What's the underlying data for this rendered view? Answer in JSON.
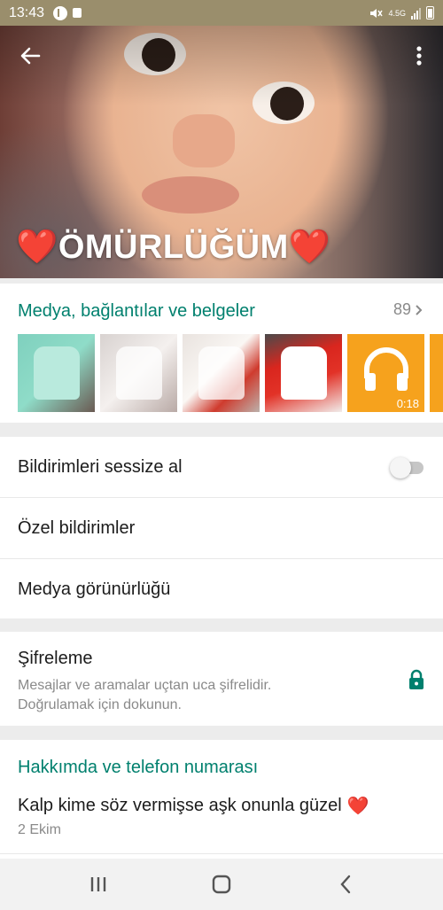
{
  "status_bar": {
    "time": "13:43",
    "network": "4.5G"
  },
  "header": {
    "name": "ÖMÜRLÜĞÜM",
    "heart": "❤️",
    "back_icon": "arrow-left-icon",
    "menu_icon": "more-vert-icon"
  },
  "media": {
    "title": "Medya, bağlantılar ve belgeler",
    "count": "89",
    "thumbnails": [
      {
        "kind": "image"
      },
      {
        "kind": "image"
      },
      {
        "kind": "image"
      },
      {
        "kind": "image"
      },
      {
        "kind": "audio",
        "duration": "0:18"
      },
      {
        "kind": "audio"
      }
    ]
  },
  "settings": {
    "mute_label": "Bildirimleri sessize al",
    "mute_enabled": false,
    "custom_notifications_label": "Özel bildirimler",
    "media_visibility_label": "Medya görünürlüğü"
  },
  "encryption": {
    "title": "Şifreleme",
    "subtitle_line1": "Mesajlar ve aramalar uçtan uca şifrelidir.",
    "subtitle_line2": "Doğrulamak için dokunun."
  },
  "about": {
    "title": "Hakkımda ve telefon numarası",
    "text": "Kalp kime söz vermişse aşk onunla güzel",
    "heart": "❤️",
    "date": "2 Ekim"
  },
  "colors": {
    "accent": "#00806e",
    "status_bar": "#9a8e6c",
    "audio_thumb": "#f6a21d"
  }
}
